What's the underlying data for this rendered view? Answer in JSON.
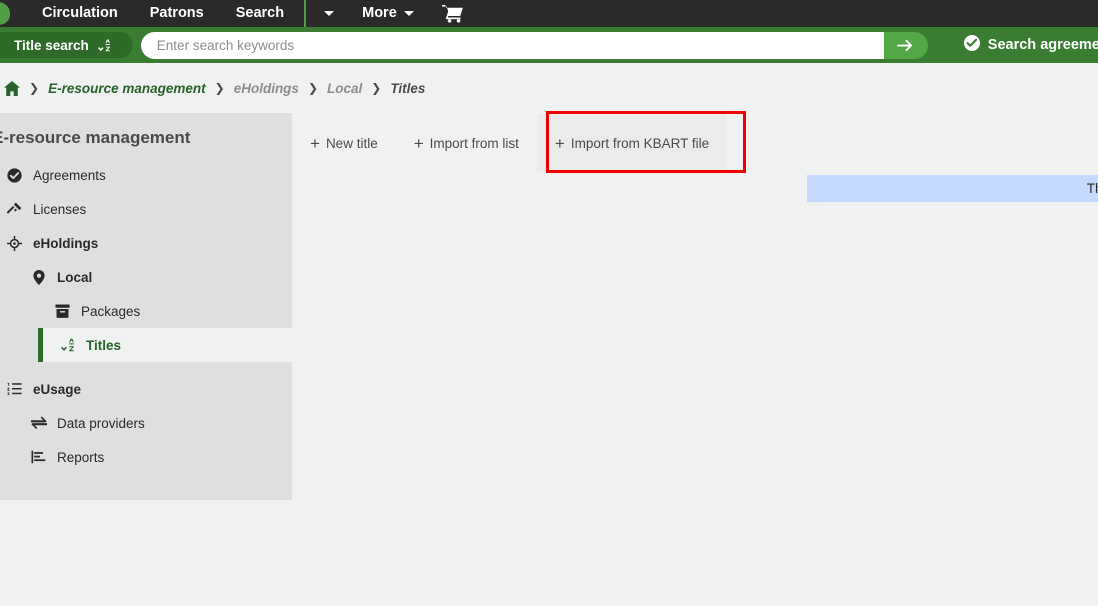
{
  "topnav": {
    "logo_icon": "folio-leaf-logo",
    "links": [
      {
        "label": "Circulation",
        "name": "nav-link-circulation"
      },
      {
        "label": "Patrons",
        "name": "nav-link-patrons"
      },
      {
        "label": "Search",
        "name": "nav-link-search"
      }
    ],
    "dropdown_caret_icon": "chevron-down-icon",
    "more_label": "More",
    "cart_icon": "shopping-cart-icon"
  },
  "search": {
    "pill_label": "Title search",
    "pill_icon": "sort-alpha-down-icon",
    "placeholder": "Enter search keywords",
    "value": "",
    "submit_icon": "arrow-right-icon",
    "agreements_label": "Search agreements",
    "agreements_icon": "check-circle-icon"
  },
  "breadcrumb": {
    "home_icon": "home-icon",
    "separator": "❯",
    "items": [
      {
        "label": "E-resource management",
        "style": "green"
      },
      {
        "label": "eHoldings",
        "style": "grey"
      },
      {
        "label": "Local",
        "style": "grey"
      },
      {
        "label": "Titles",
        "style": "dark"
      }
    ]
  },
  "sidebar": {
    "title": "E-resource management",
    "items": [
      {
        "label": "Agreements",
        "icon": "check-circle-icon",
        "level": 0,
        "bold": false,
        "selected": false
      },
      {
        "label": "Licenses",
        "icon": "gavel-icon",
        "level": 0,
        "bold": false,
        "selected": false
      },
      {
        "label": "eHoldings",
        "icon": "crosshair-icon",
        "level": 0,
        "bold": true,
        "selected": false
      },
      {
        "label": "Local",
        "icon": "map-pin-icon",
        "level": 1,
        "bold": true,
        "selected": false
      },
      {
        "label": "Packages",
        "icon": "archive-box-icon",
        "level": 2,
        "bold": false,
        "selected": false
      },
      {
        "label": "Titles",
        "icon": "sort-alpha-down-icon",
        "level": 2,
        "bold": true,
        "selected": true
      },
      {
        "label": "eUsage",
        "icon": "list-ordered-icon",
        "level": 0,
        "bold": true,
        "selected": false
      },
      {
        "label": "Data providers",
        "icon": "exchange-arrows-icon",
        "level": 1,
        "bold": false,
        "selected": false
      },
      {
        "label": "Reports",
        "icon": "bar-chart-icon",
        "level": 1,
        "bold": false,
        "selected": false
      }
    ]
  },
  "main": {
    "actions": [
      {
        "label": "New title",
        "icon": "plus-icon",
        "name": "new-title-button",
        "highlighted": false
      },
      {
        "label": "Import from list",
        "icon": "plus-icon",
        "name": "import-from-list-button",
        "highlighted": false
      },
      {
        "label": "Import from KBART file",
        "icon": "plus-icon",
        "name": "import-from-kbart-button",
        "highlighted": true
      }
    ],
    "highlight_color": "#ef0000",
    "banner_text": "There are no",
    "banner_color": "#c5d8fd"
  }
}
